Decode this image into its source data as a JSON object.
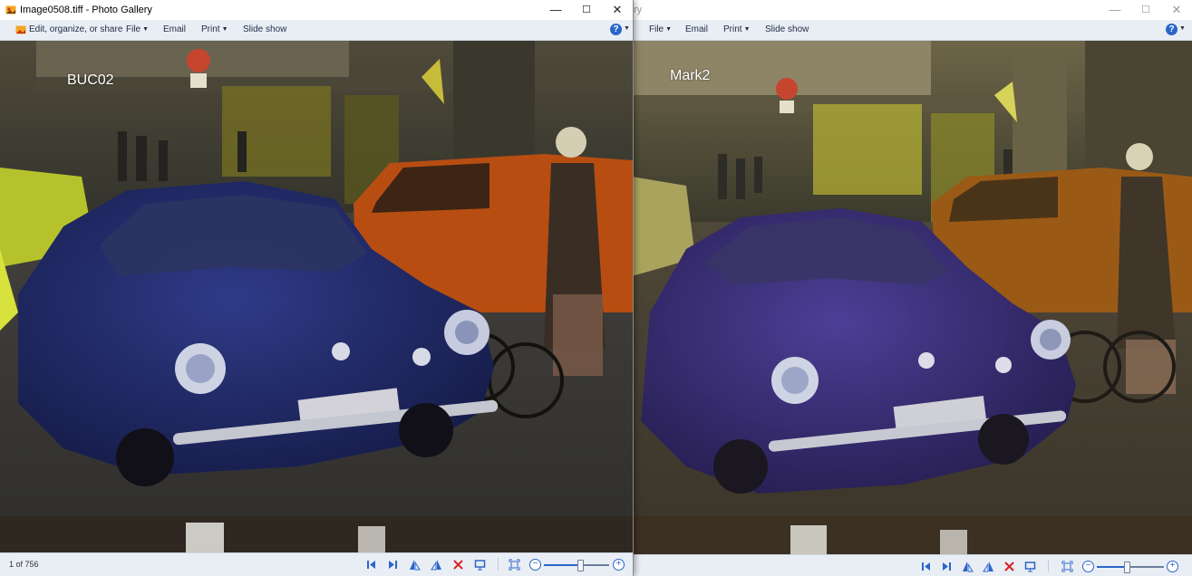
{
  "left_window": {
    "title": "Image0508.tiff - Photo Gallery",
    "toolbar": {
      "edit_label": "Edit, organize, or share",
      "file_label": "File",
      "email_label": "Email",
      "print_label": "Print",
      "slideshow_label": "Slide show",
      "help_label": "?"
    },
    "photo_label": "BUC02",
    "status": {
      "counter": "1 of 756"
    },
    "zoom": {
      "level": 0.55
    }
  },
  "right_window": {
    "title_fragment": "ry",
    "toolbar": {
      "file_label": "File",
      "email_label": "Email",
      "print_label": "Print",
      "slideshow_label": "Slide show",
      "help_label": "?"
    },
    "photo_label": "Mark2",
    "zoom": {
      "level": 0.45
    }
  },
  "window_controls": {
    "minimize": "—",
    "maximize": "☐",
    "close": "✕"
  },
  "icons": {
    "first": "skip-first-icon",
    "last": "skip-last-icon",
    "rotate_left": "rotate-left-icon",
    "rotate_right": "rotate-right-icon",
    "delete": "delete-icon",
    "slideshow": "slideshow-icon",
    "fit": "actual-size-icon",
    "zoom_out": "zoom-out-icon",
    "zoom_in": "zoom-in-icon"
  },
  "colors": {
    "toolbar_bg": "#e9eef5",
    "accent_blue": "#2a66c9",
    "delete_red": "#d92020",
    "label_white": "#ffffff"
  }
}
